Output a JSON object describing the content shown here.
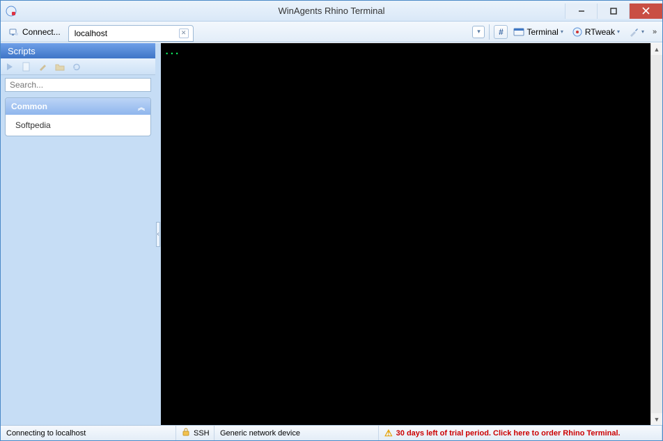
{
  "window": {
    "title": "WinAgents Rhino Terminal"
  },
  "toolbar": {
    "connect_label": "Connect...",
    "terminal_label": "Terminal",
    "rtweak_label": "RTweak"
  },
  "tabs": [
    {
      "label": "localhost"
    }
  ],
  "sidebar": {
    "title": "Scripts",
    "search_placeholder": "Search...",
    "groups": [
      {
        "title": "Common",
        "items": [
          "Softpedia"
        ]
      }
    ]
  },
  "terminal": {
    "prompt": "..."
  },
  "status": {
    "connection": "Connecting to localhost",
    "protocol": "SSH",
    "device": "Generic network device",
    "trial": "30 days left of trial period. Click here to order Rhino Terminal."
  }
}
